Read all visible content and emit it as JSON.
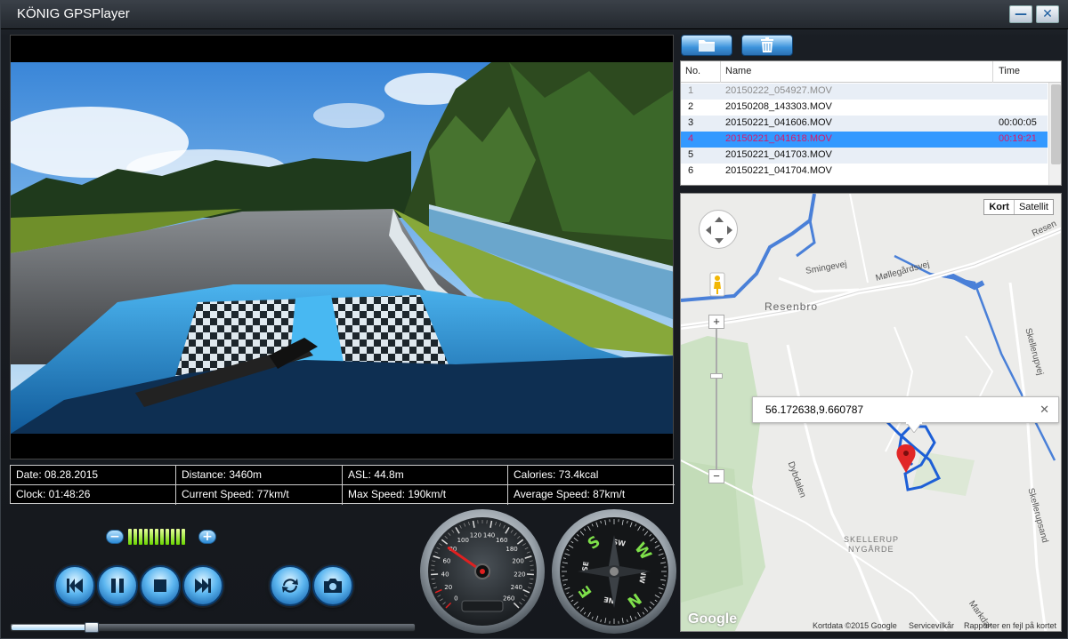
{
  "app": {
    "title": "KÖNIG GPSPlayer"
  },
  "window_controls": {
    "minimize": "—",
    "close": "✕"
  },
  "colors": {
    "accent": "#3399ff",
    "selected_text": "#d8196b",
    "route": "#1d5fd6",
    "pin": "#e12727"
  },
  "info": {
    "date": "Date: 08.28.2015",
    "distance": "Distance: 3460m",
    "asl": "ASL: 44.8m",
    "calories": "Calories: 73.4kcal",
    "clock": "Clock: 01:48:26",
    "current_speed": "Current Speed: 77km/t",
    "max_speed": "Max Speed: 190km/t",
    "average_speed": "Average Speed: 87km/t"
  },
  "volume": {
    "minus": "−",
    "plus": "+",
    "level_bars": 11
  },
  "playback": {
    "buttons": [
      "previous",
      "pause",
      "stop",
      "next",
      "repeat",
      "snapshot"
    ],
    "progress": 0.2
  },
  "speedometer": {
    "ticks": [
      "0",
      "20",
      "40",
      "60",
      "80",
      "100",
      "120",
      "140",
      "160",
      "180",
      "200",
      "220",
      "240",
      "260"
    ],
    "speed": 77
  },
  "compass": {
    "labels": [
      "S",
      "SW",
      "W",
      "NW",
      "N",
      "NE",
      "E",
      "SE"
    ]
  },
  "file_list": {
    "headers": {
      "no": "No.",
      "name": "Name",
      "time": "Time"
    },
    "rows": [
      {
        "no": "1",
        "name": "20150222_054927.MOV",
        "time": "",
        "state": "disabled"
      },
      {
        "no": "2",
        "name": "20150208_143303.MOV",
        "time": "",
        "state": "normal"
      },
      {
        "no": "3",
        "name": "20150221_041606.MOV",
        "time": "00:00:05",
        "state": "normal"
      },
      {
        "no": "4",
        "name": "20150221_041618.MOV",
        "time": "00:19:21",
        "state": "selected"
      },
      {
        "no": "5",
        "name": "20150221_041703.MOV",
        "time": "",
        "state": "normal"
      },
      {
        "no": "6",
        "name": "20150221_041704.MOV",
        "time": "",
        "state": "normal"
      }
    ]
  },
  "map": {
    "type_buttons": {
      "map": "Kort",
      "satellite": "Satellit"
    },
    "zoom": {
      "in": "+",
      "out": "−"
    },
    "info_window": {
      "coords": "56.172638,9.660787",
      "close": "✕"
    },
    "labels": {
      "resenbro": "Resenbro",
      "smingevej": "Smingevej",
      "mollegardsvej": "Møllegårdsvej",
      "resen": "Resen",
      "skellerupvej": "Skellerupvej",
      "dybdalen": "Dybdalen",
      "skellerup_1": "SKELLERUP",
      "skellerup_2": "NYGÅRDE",
      "skellerupsand": "Skellerupsand",
      "markdal": "Markdal"
    },
    "footer": {
      "logo": "Google",
      "data": "Kortdata ©2015 Google",
      "terms": "Servicevilkår",
      "report": "Rapporter en fejl på kortet"
    }
  }
}
